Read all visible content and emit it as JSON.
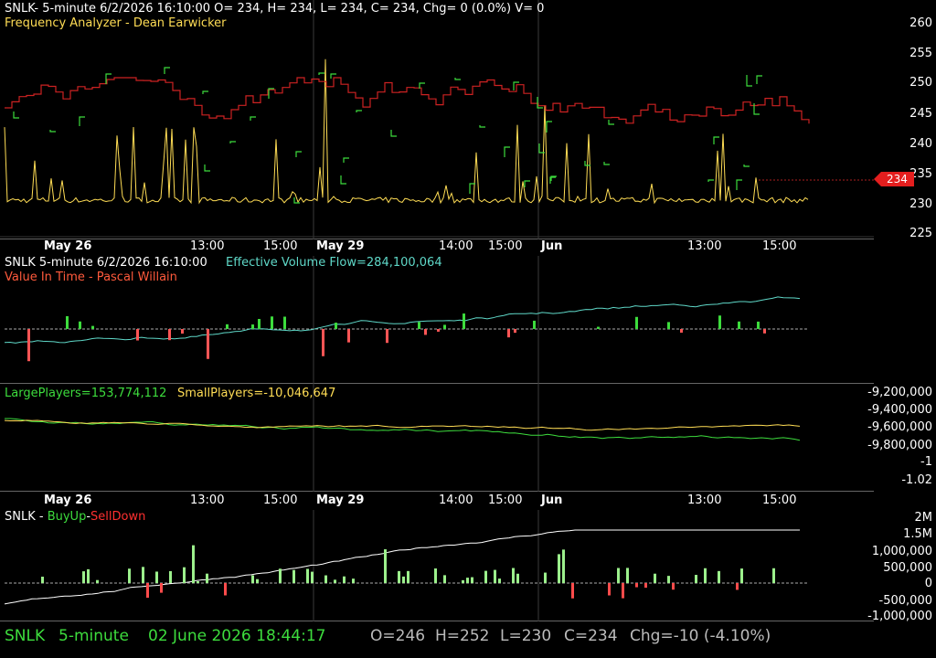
{
  "colors": {
    "green": "#3ddc3d",
    "red": "#ff4b4b",
    "yellow": "#ffdd55",
    "cyan": "#5fd8c8",
    "white": "#ffffff",
    "grid": "#444"
  },
  "panel1": {
    "header": "SNLK- 5-minute 6/2/2026 16:10:00 O= 234, H= 234, L= 234, C= 234, Chg= 0 (0.0%) V= 0",
    "indicator": "Frequency Analyzer - Dean Earwicker",
    "yaxis": [
      "260",
      "255",
      "250",
      "245",
      "240",
      "235",
      "230",
      "225"
    ],
    "price_tag": "234"
  },
  "date_axis": {
    "labels": [
      "May 26",
      "13:00",
      "15:00",
      "May 29",
      "14:00",
      "15:00",
      "Jun",
      "13:00",
      "15:00"
    ]
  },
  "panel2": {
    "header_symbol": "SNLK 5-minute  6/2/2026 16:10:00",
    "header_flow": "Effective Volume Flow=284,100,064",
    "indicator": "Value In Time - Pascal Willain"
  },
  "panel3": {
    "large": "LargePlayers=153,774,112",
    "small": "SmallPlayers=-10,046,647",
    "yaxis": [
      "-9,200,000",
      "-9,400,000",
      "-9,600,000",
      "-9,800,000",
      "-1",
      "-1.02"
    ]
  },
  "panel4": {
    "symbol": "SNLK - ",
    "buy": "BuyUp",
    "dash": "-",
    "sell": "SellDown",
    "yaxis": [
      "2M",
      "1.5M",
      "1,000,000",
      "500,000",
      "0",
      "-500,000",
      "-1,000,000"
    ]
  },
  "footer": {
    "symbol": "SNLK",
    "interval": "5-minute",
    "datetime": "02 June 2026 18:44:17",
    "open": "O=246",
    "high": "H=252",
    "low": "L=230",
    "close": "C=234",
    "change": "Chg=-10 (-4.10%)"
  }
}
